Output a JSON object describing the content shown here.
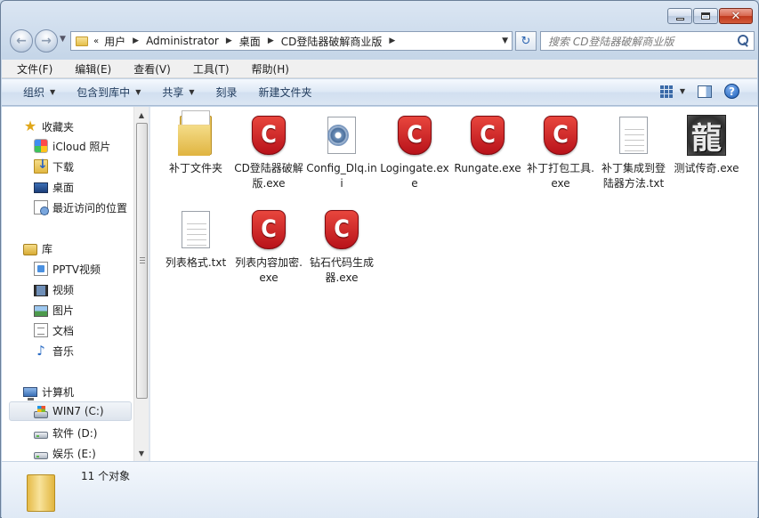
{
  "window": {
    "caption": {
      "min": "minimize",
      "max": "maximize",
      "close": "✕"
    }
  },
  "address": {
    "crumbs": [
      "用户",
      "Administrator",
      "桌面",
      "CD登陆器破解商业版"
    ],
    "lead": "«"
  },
  "search": {
    "placeholder": "搜索 CD登陆器破解商业版"
  },
  "menu": [
    "文件(F)",
    "编辑(E)",
    "查看(V)",
    "工具(T)",
    "帮助(H)"
  ],
  "toolbar": {
    "organize": "组织",
    "include": "包含到库中",
    "share": "共享",
    "burn": "刻录",
    "new_folder": "新建文件夹"
  },
  "sidebar": {
    "favorites": "收藏夹",
    "fav_items": [
      "iCloud 照片",
      "下载",
      "桌面",
      "最近访问的位置"
    ],
    "libraries": "库",
    "lib_items": [
      "PPTV视频",
      "视频",
      "图片",
      "文档",
      "音乐"
    ],
    "computer": "计算机",
    "drives": [
      "WIN7 (C:)",
      "软件 (D:)",
      "娱乐 (E:)"
    ]
  },
  "files": [
    {
      "name": "补丁文件夹",
      "icon": "folder-icon"
    },
    {
      "name": "CD登陆器破解版.exe",
      "icon": "cd-app-icon"
    },
    {
      "name": "Config_Dlq.ini",
      "icon": "settings-file-icon"
    },
    {
      "name": "Logingate.exe",
      "icon": "cd-app-icon"
    },
    {
      "name": "Rungate.exe",
      "icon": "cd-app-icon"
    },
    {
      "name": "补丁打包工具.exe",
      "icon": "cd-app-icon"
    },
    {
      "name": "补丁集成到登陆器方法.txt",
      "icon": "text-file-icon"
    },
    {
      "name": "测试传奇.exe",
      "icon": "dragon-app-icon"
    },
    {
      "name": "列表格式.txt",
      "icon": "text-file-icon"
    },
    {
      "name": "列表内容加密.exe",
      "icon": "cd-app-icon"
    },
    {
      "name": "钻石代码生成器.exe",
      "icon": "cd-app-icon"
    }
  ],
  "icons": {
    "cd_letter": "C",
    "dragon_glyph": "龍"
  },
  "status": {
    "count": "11 个对象"
  }
}
